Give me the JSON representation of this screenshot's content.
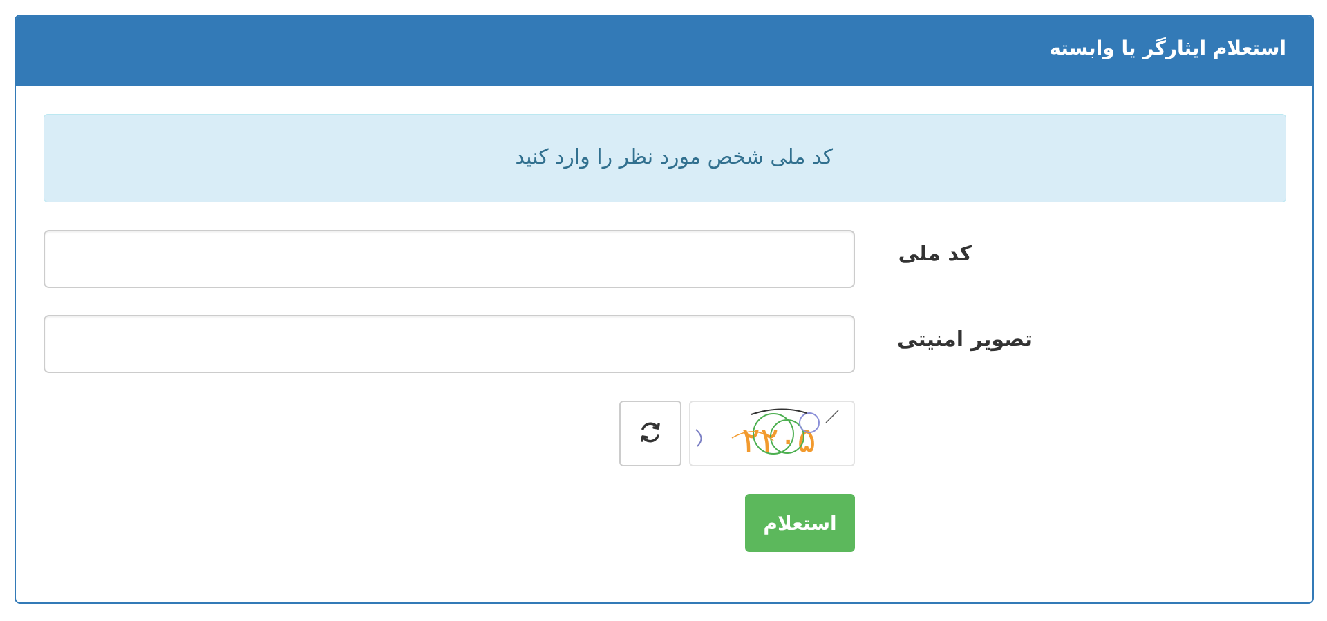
{
  "panel": {
    "title": "استعلام ایثارگر یا وابسته"
  },
  "alert": {
    "message": "کد ملی شخص مورد نظر را وارد کنید"
  },
  "form": {
    "national_code": {
      "label": "کد ملی",
      "value": ""
    },
    "captcha": {
      "label": "تصویر امنیتی",
      "value": "",
      "image_text": "۲۲۰۵"
    },
    "refresh_icon": "refresh-icon",
    "submit_label": "استعلام"
  },
  "colors": {
    "primary": "#337ab7",
    "alert_bg": "#d9edf7",
    "alert_text": "#31708f",
    "success": "#5cb85c"
  }
}
